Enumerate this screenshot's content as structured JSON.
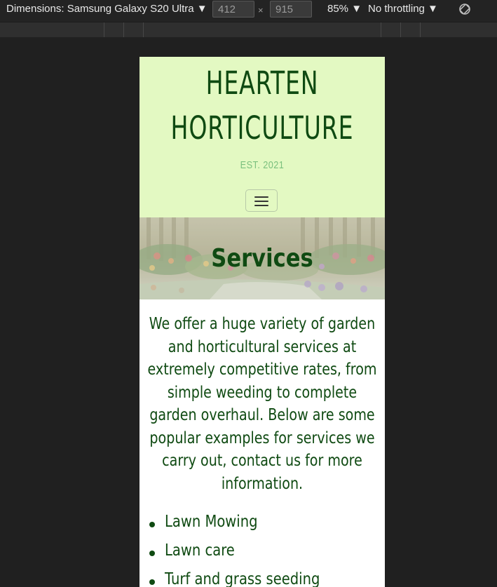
{
  "devtools": {
    "dimensions_label": "Dimensions: Samsung Galaxy S20 Ultra ▼",
    "width": "412",
    "height": "915",
    "times": "×",
    "zoom": "85% ▼",
    "throttling": "No throttling ▼"
  },
  "site": {
    "brand_line1": "HEARTEN",
    "brand_line2": "HORTICULTURE",
    "est": "EST. 2021",
    "hero_title": "Services",
    "intro": "We offer a huge variety of garden and horticultural services at extremely competitive rates, from simple weeding to complete garden overhaul. Below are some popular examples for services we carry out, contact us for more information.",
    "services": [
      {
        "label": "Lawn Mowing"
      },
      {
        "label": "Lawn care"
      },
      {
        "label": "Turf and grass seeding"
      }
    ]
  },
  "colors": {
    "brand_green": "#0f4a12",
    "header_bg": "#e3f9c2",
    "est_green": "#7bc07e"
  }
}
